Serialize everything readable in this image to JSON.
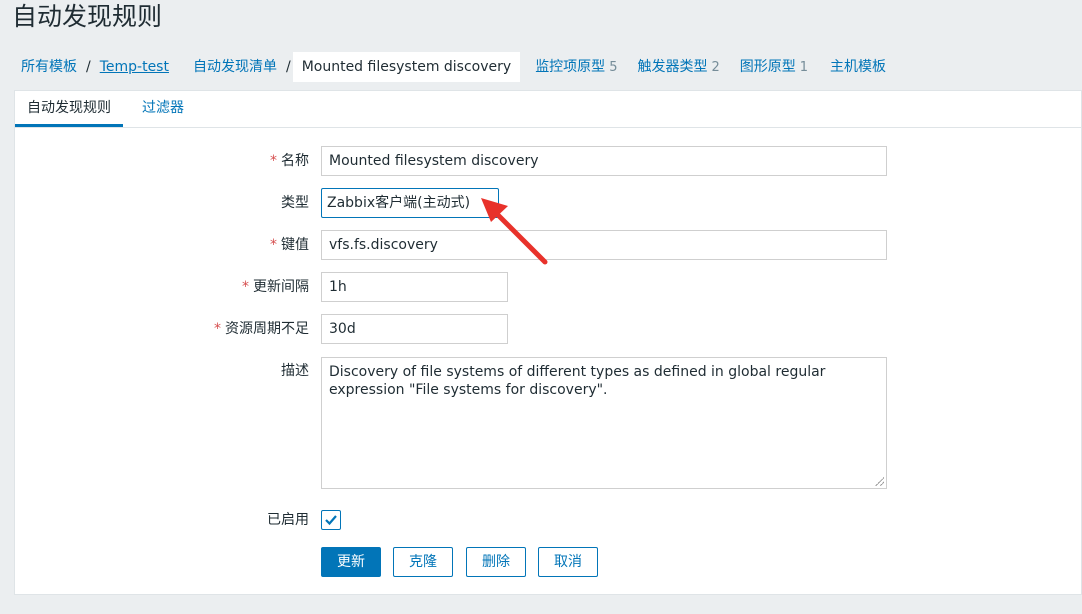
{
  "page": {
    "title": "自动发现规则"
  },
  "breadcrumbs": {
    "all_templates": "所有模板",
    "separator": "/",
    "template": "Temp-test",
    "discovery_list": "自动发现清单",
    "current": "Mounted filesystem discovery"
  },
  "nav": [
    {
      "label": "监控项原型",
      "count": "5"
    },
    {
      "label": "触发器类型",
      "count": "2"
    },
    {
      "label": "图形原型",
      "count": "1"
    },
    {
      "label": "主机模板",
      "count": ""
    }
  ],
  "tabs": {
    "rule": "自动发现规则",
    "filters": "过滤器"
  },
  "form": {
    "required_mark": "*",
    "name": {
      "label": "名称",
      "value": "Mounted filesystem discovery"
    },
    "type": {
      "label": "类型",
      "value": "Zabbix客户端(主动式)"
    },
    "key": {
      "label": "键值",
      "value": "vfs.fs.discovery"
    },
    "interval": {
      "label": "更新间隔",
      "value": "1h"
    },
    "lifetime": {
      "label": "资源周期不足",
      "value": "30d"
    },
    "description": {
      "label": "描述",
      "value": "Discovery of file systems of different types as defined in global regular expression \"File systems for discovery\"."
    },
    "enabled": {
      "label": "已启用",
      "checked": true
    }
  },
  "buttons": {
    "update": "更新",
    "clone": "克隆",
    "delete": "删除",
    "cancel": "取消"
  },
  "colors": {
    "accent": "#0275b8",
    "required": "#d64e4e",
    "annotation_arrow": "#e8322b"
  }
}
